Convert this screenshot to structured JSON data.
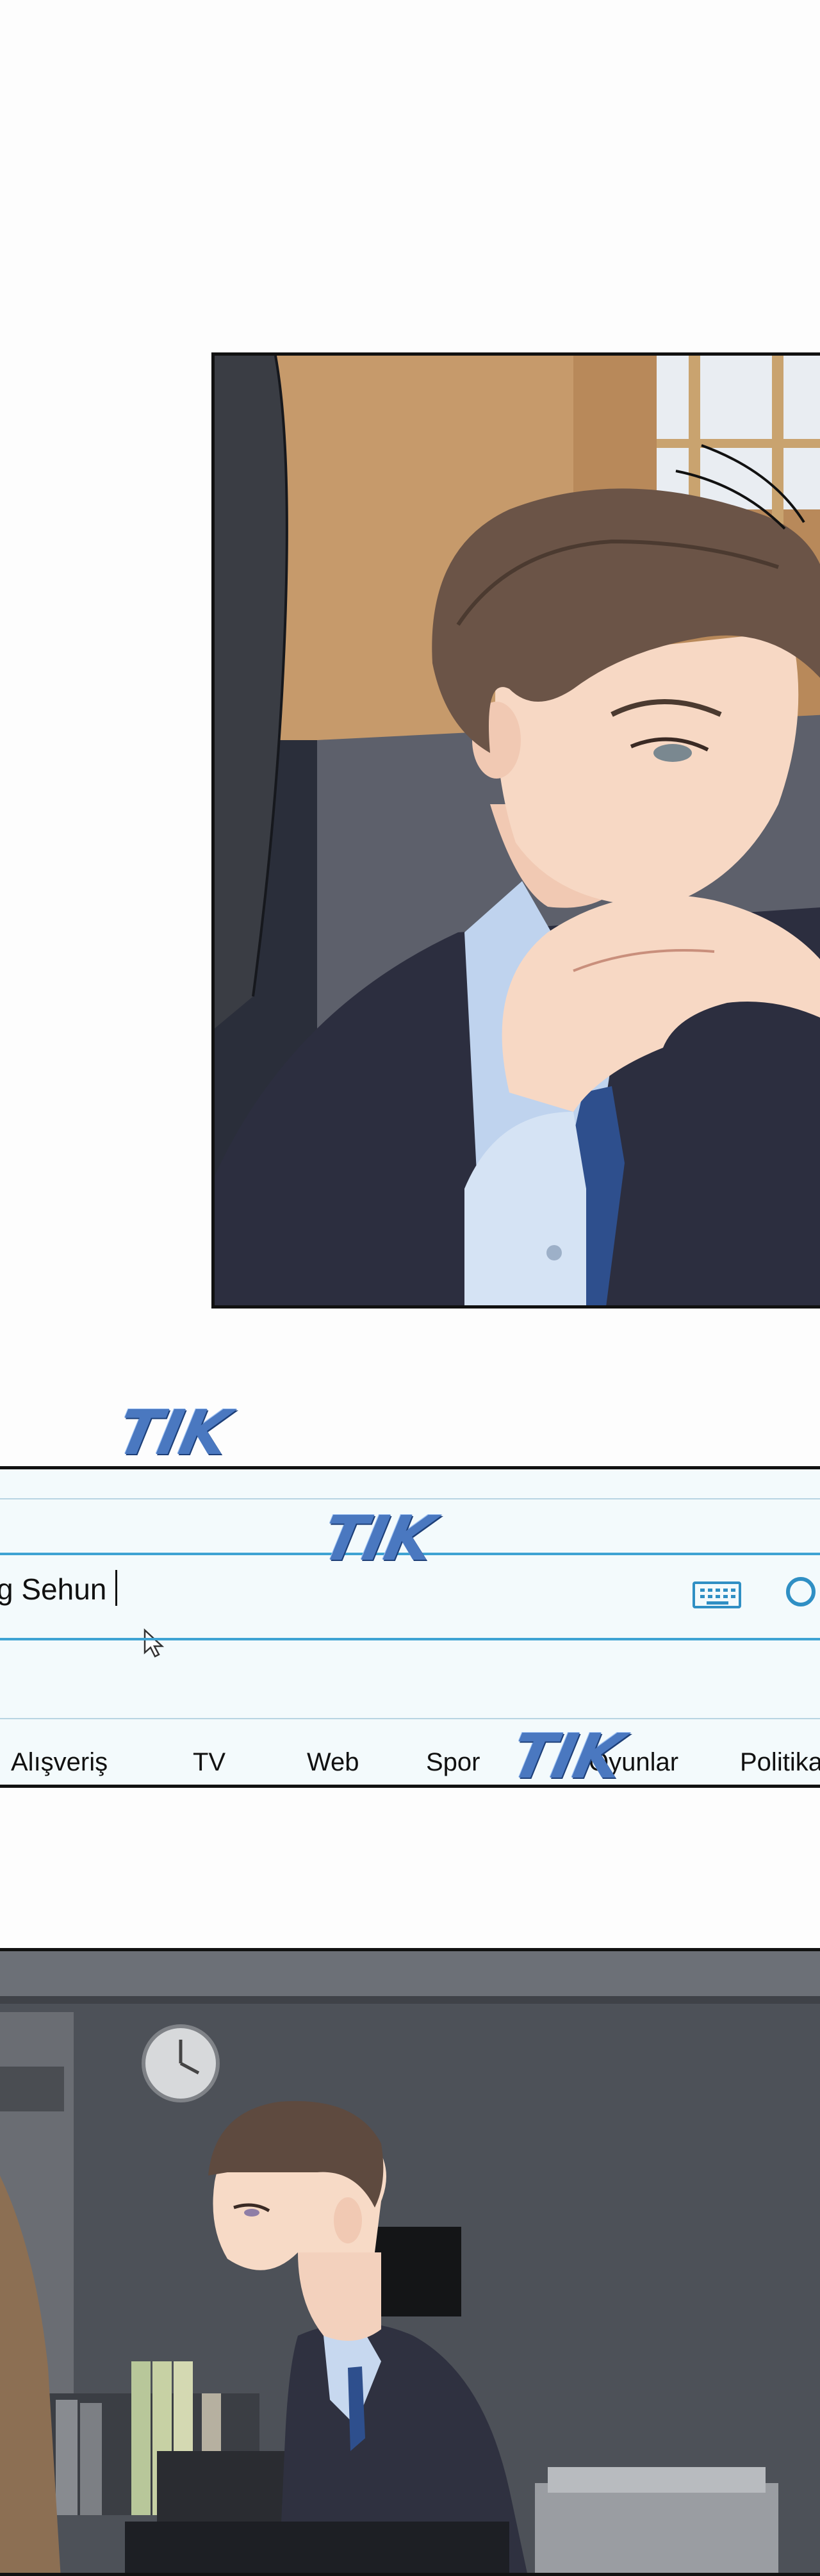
{
  "sfx": [
    "TIK",
    "TIK",
    "TIK"
  ],
  "search": {
    "query": "g Sehun"
  },
  "nav_items": [
    "Alışveriş",
    "TV",
    "Web",
    "Spor",
    "Oyunlar",
    "Politika"
  ],
  "colors": {
    "accent": "#3ea3d3",
    "sfx": "#4a78c0",
    "panel_border": "#111111"
  },
  "icons": [
    "keyboard-icon",
    "search-icon",
    "mouse-pointer-icon",
    "wall-clock-icon"
  ]
}
